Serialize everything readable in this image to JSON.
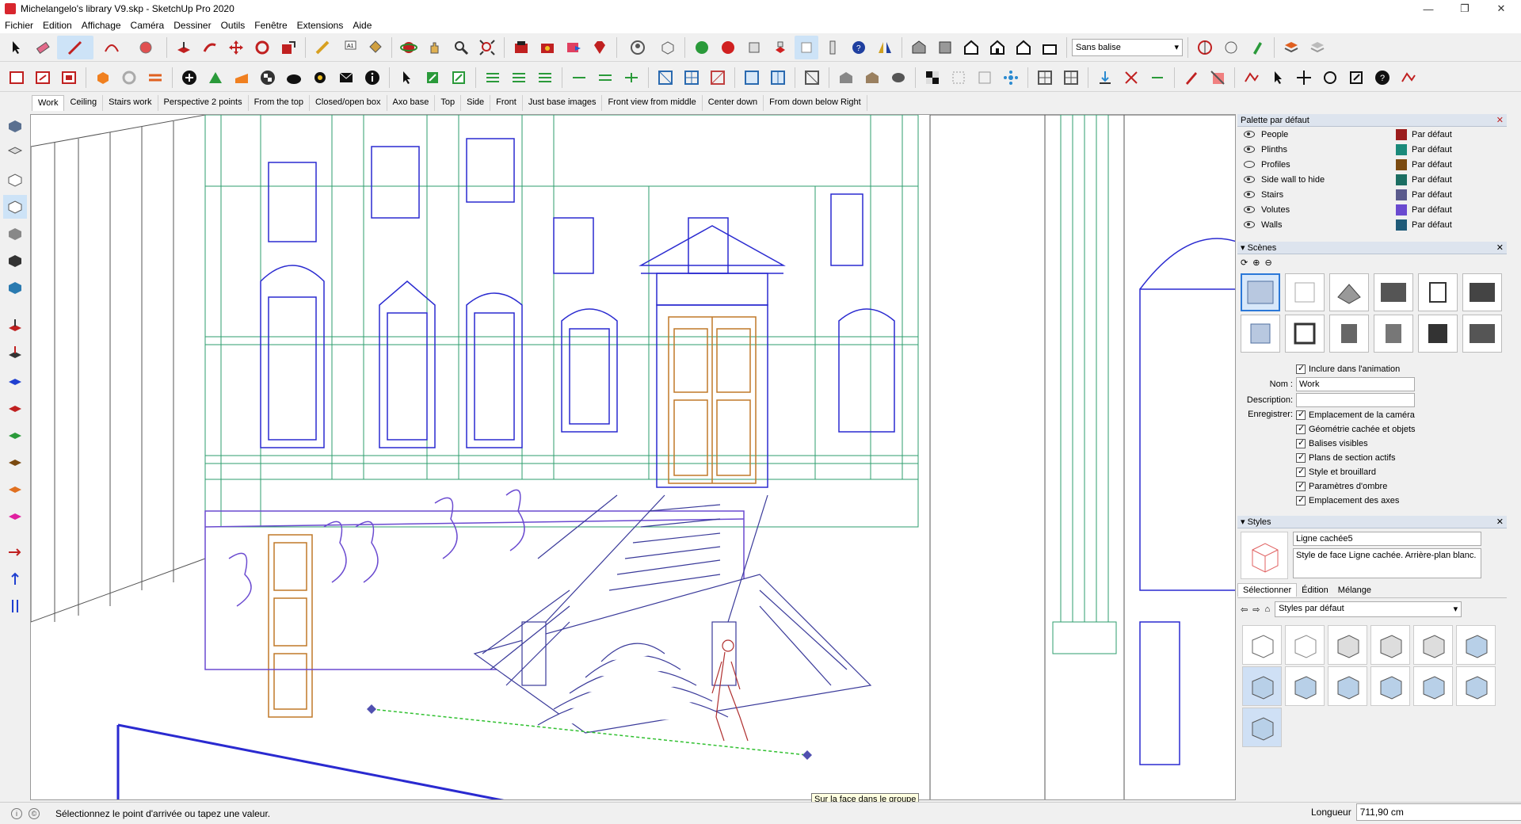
{
  "window": {
    "title": "Michelangelo's library V9.skp - SketchUp Pro 2020",
    "minimize": "—",
    "maximize": "❐",
    "close": "✕"
  },
  "menu": [
    "Fichier",
    "Edition",
    "Affichage",
    "Caméra",
    "Dessiner",
    "Outils",
    "Fenêtre",
    "Extensions",
    "Aide"
  ],
  "toolbar": {
    "tag_selector": "Sans balise"
  },
  "scene_tabs": [
    "Work",
    "Ceiling",
    "Stairs work",
    "Perspective 2 points",
    "From the top",
    "Closed/open box",
    "Axo base",
    "Top",
    "Side",
    "Front",
    "Just base images",
    "Front view from middle",
    "Center down",
    "From down below Right"
  ],
  "tags_panel": {
    "title": "Palette par défaut",
    "rows": [
      {
        "name": "People",
        "visible": true,
        "color": "#9b1c1c",
        "value": "Par défaut"
      },
      {
        "name": "Plinths",
        "visible": true,
        "color": "#1a8a7a",
        "value": "Par défaut"
      },
      {
        "name": "Profiles",
        "visible": false,
        "color": "#7a4a10",
        "value": "Par défaut"
      },
      {
        "name": "Side wall to hide",
        "visible": true,
        "color": "#1b6e62",
        "value": "Par défaut"
      },
      {
        "name": "Stairs",
        "visible": true,
        "color": "#5a5a8c",
        "value": "Par défaut"
      },
      {
        "name": "Volutes",
        "visible": true,
        "color": "#6a4ad0",
        "value": "Par défaut"
      },
      {
        "name": "Walls",
        "visible": true,
        "color": "#1f5a78",
        "value": "Par défaut"
      }
    ]
  },
  "scenes_panel": {
    "title": "Scènes",
    "include_animation": "Inclure dans l'animation",
    "name_label": "Nom :",
    "name_value": "Work",
    "description_label": "Description:",
    "description_value": "",
    "save_label": "Enregistrer:",
    "save_options": [
      "Emplacement de la caméra",
      "Géométrie cachée et objets",
      "Balises visibles",
      "Plans de section actifs",
      "Style et brouillard",
      "Paramètres d'ombre",
      "Emplacement des axes"
    ]
  },
  "styles_panel": {
    "title": "Styles",
    "style_name": "Ligne cachée5",
    "style_description": "Style de face Ligne cachée. Arrière-plan blanc.",
    "tabs": [
      "Sélectionner",
      "Édition",
      "Mélange"
    ],
    "collection": "Styles par défaut"
  },
  "status": {
    "message": "Sélectionnez le point d'arrivée ou tapez une valeur.",
    "measure_label": "Longueur",
    "measure_value": "711,90 cm"
  },
  "tooltip": "Sur la face dans le groupe",
  "colors": {
    "wall_green": "#2e9e6e",
    "wall_blue": "#2a2ad0",
    "wall_purple": "#6a4ad0",
    "door_orange": "#c07828",
    "inference_green": "#30c030",
    "person_red": "#b03030"
  }
}
